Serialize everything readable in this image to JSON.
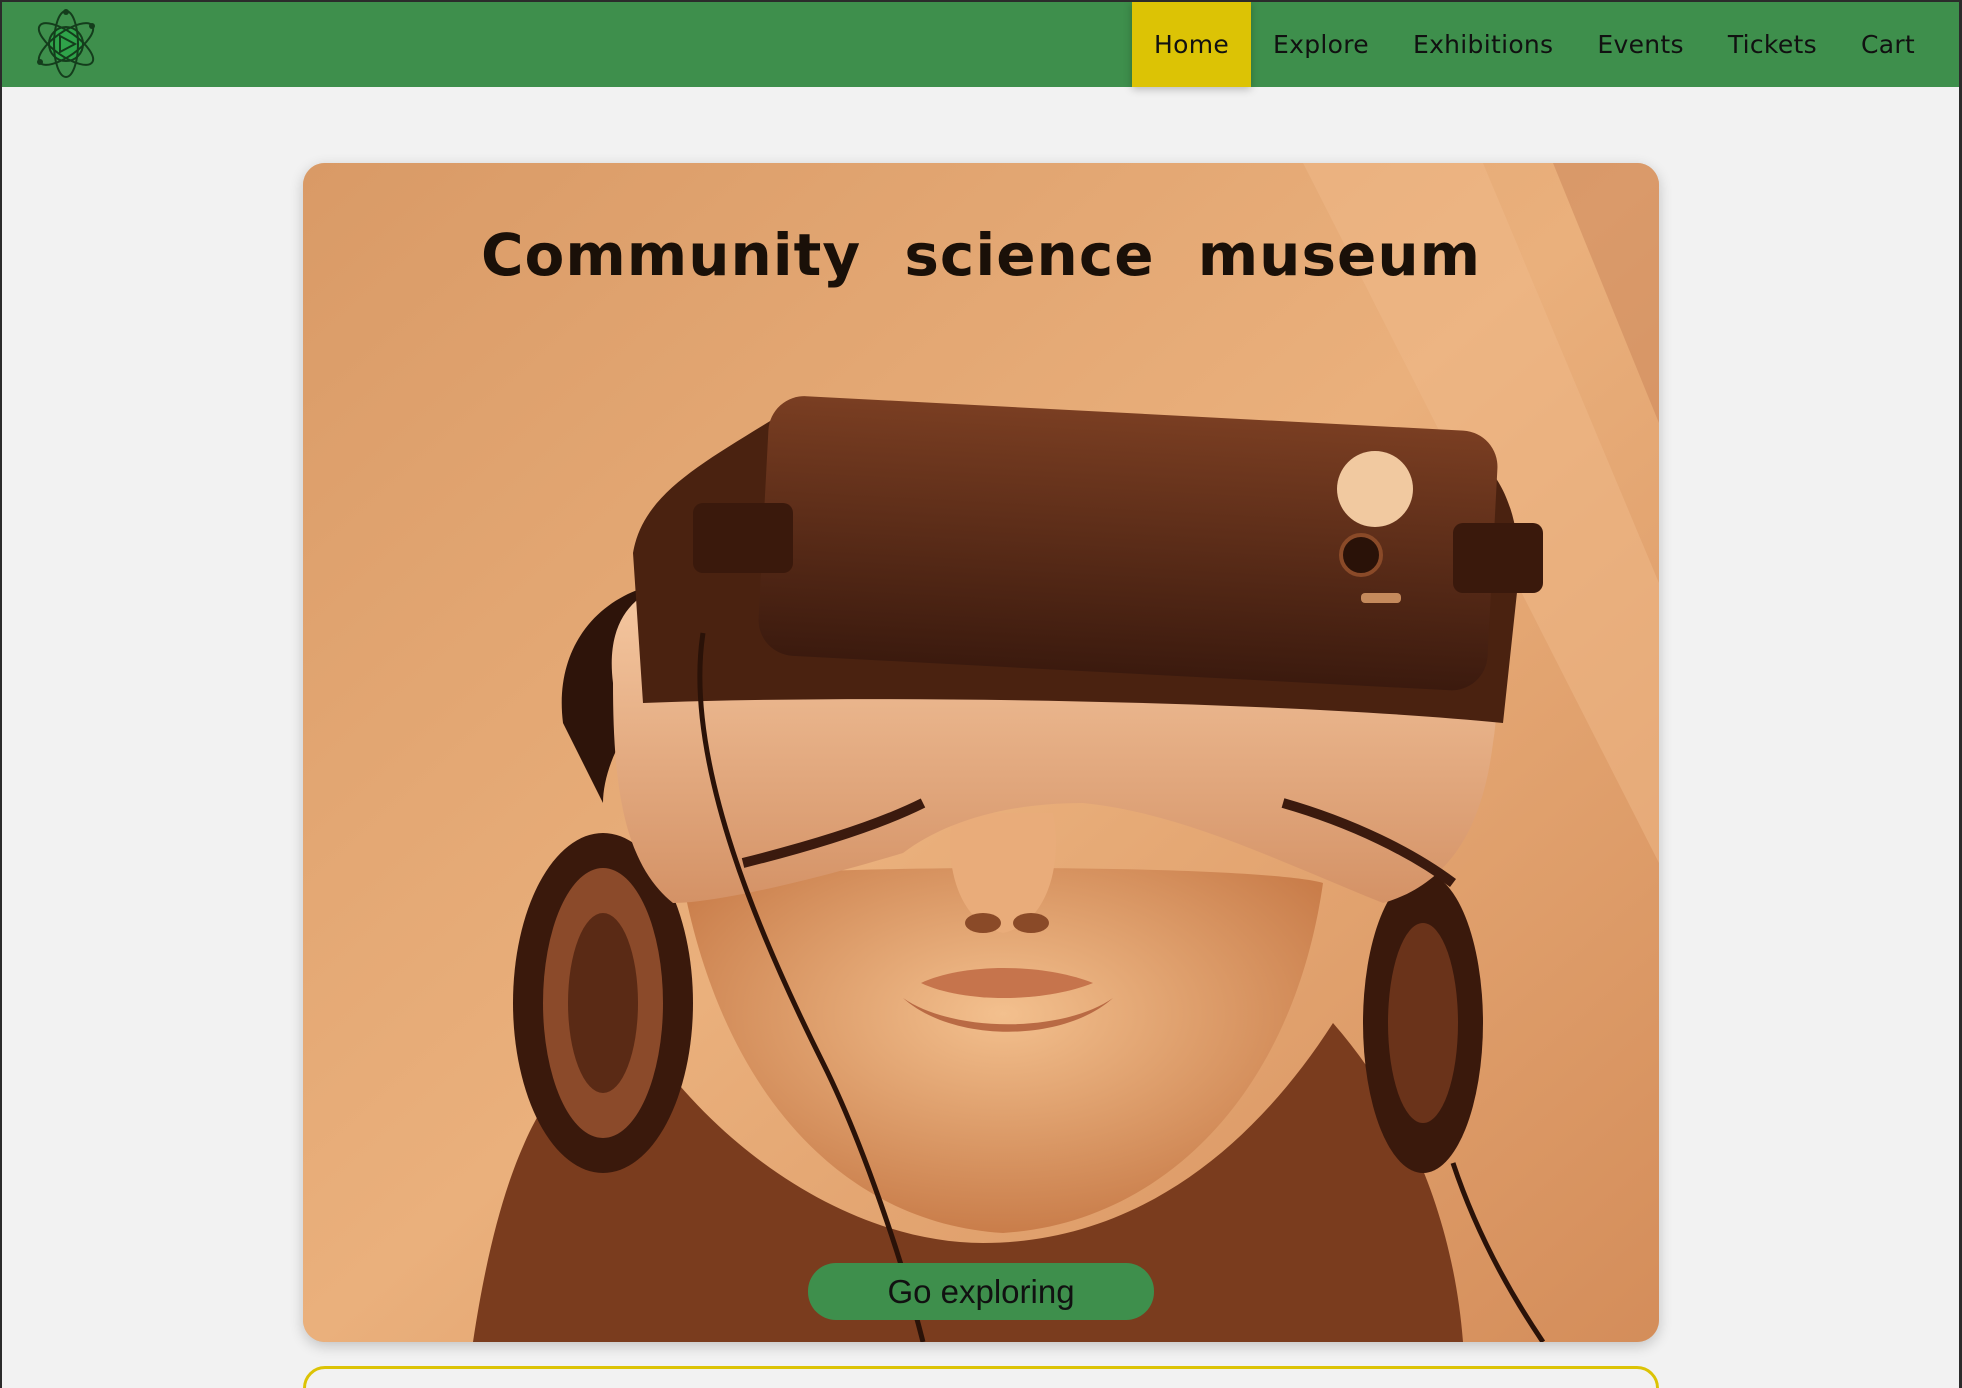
{
  "nav": {
    "items": [
      {
        "label": "Home",
        "active": true
      },
      {
        "label": "Explore",
        "active": false
      },
      {
        "label": "Exhibitions",
        "active": false
      },
      {
        "label": "Events",
        "active": false
      },
      {
        "label": "Tickets",
        "active": false
      },
      {
        "label": "Cart",
        "active": false
      }
    ]
  },
  "logo": {
    "icon": "atom-icon"
  },
  "hero": {
    "title": "Community science museum",
    "image": "person-wearing-vr-headset-and-headphones",
    "cta_label": "Go exploring"
  },
  "colors": {
    "nav_bg": "#3e8f4c",
    "active_bg": "#dcc305",
    "cta_bg": "#3e8f4c",
    "page_bg": "#f2f2f2",
    "hero_tint": "#e3a46c"
  }
}
